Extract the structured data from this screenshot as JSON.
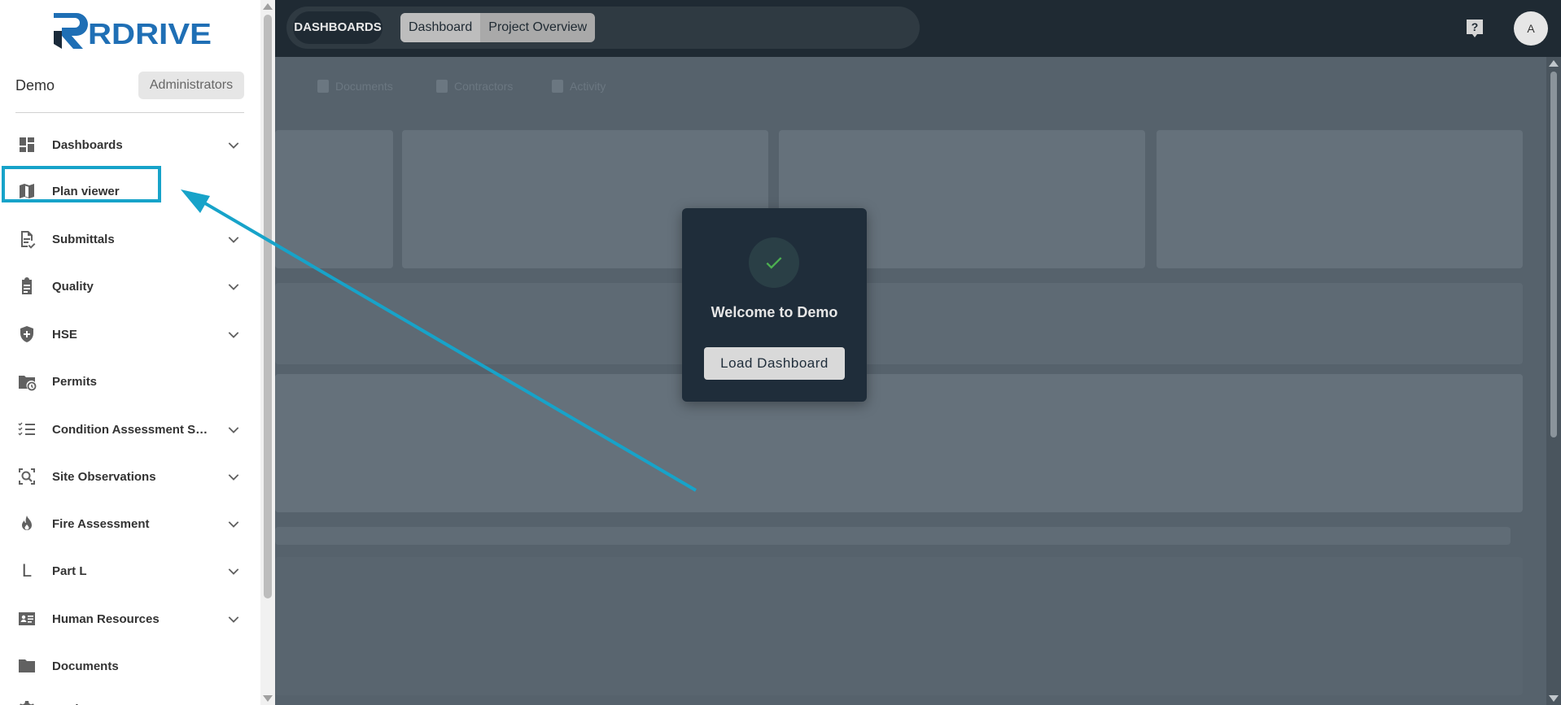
{
  "brand": {
    "logo_text": "RDRIVE",
    "accent": "#1f6fb5",
    "dark": "#1a2a3a"
  },
  "user": {
    "name": "Demo",
    "role": "Administrators"
  },
  "sidebar": {
    "items": [
      {
        "label": "Dashboards",
        "icon": "dashboard-icon",
        "expandable": true
      },
      {
        "label": "Plan viewer",
        "icon": "map-icon",
        "expandable": false
      },
      {
        "label": "Submittals",
        "icon": "document-check-icon",
        "expandable": true
      },
      {
        "label": "Quality",
        "icon": "clipboard-icon",
        "expandable": true
      },
      {
        "label": "HSE",
        "icon": "shield-plus-icon",
        "expandable": true
      },
      {
        "label": "Permits",
        "icon": "folder-clock-icon",
        "expandable": false
      },
      {
        "label": "Condition Assessment Surv...",
        "icon": "checklist-icon",
        "expandable": true
      },
      {
        "label": "Site Observations",
        "icon": "zoom-scan-icon",
        "expandable": true
      },
      {
        "label": "Fire Assessment",
        "icon": "flame-icon",
        "expandable": true
      },
      {
        "label": "Part L",
        "icon": "letter-l-icon",
        "expandable": true
      },
      {
        "label": "Human Resources",
        "icon": "id-card-icon",
        "expandable": true
      },
      {
        "label": "Documents",
        "icon": "folder-icon",
        "expandable": false
      },
      {
        "label": "Settings",
        "icon": "gear-icon",
        "expandable": true
      }
    ]
  },
  "topbar": {
    "section_label": "DASHBOARDS",
    "tabs": [
      {
        "label": "Dashboard",
        "active": true
      },
      {
        "label": "Project Overview",
        "active": false
      }
    ],
    "avatar_initial": "A"
  },
  "background_tabs": [
    "Documents",
    "Contractors",
    "Activity"
  ],
  "dialog": {
    "title": "Welcome to Demo",
    "button_label": "Load Dashboard"
  },
  "colors": {
    "highlight": "#17a3c9",
    "success": "#4caf50"
  }
}
